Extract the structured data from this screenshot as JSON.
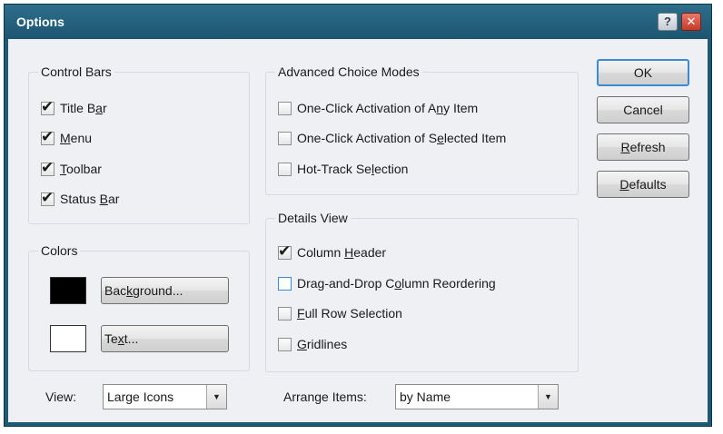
{
  "window": {
    "title": "Options",
    "help_label": "?",
    "close_label": "✕"
  },
  "control_bars": {
    "title": "Control Bars",
    "items": [
      {
        "pre": "Title B",
        "key": "a",
        "post": "r",
        "checked": true
      },
      {
        "pre": "",
        "key": "M",
        "post": "enu",
        "checked": true
      },
      {
        "pre": "",
        "key": "T",
        "post": "oolbar",
        "checked": true
      },
      {
        "pre": "Status ",
        "key": "B",
        "post": "ar",
        "checked": true
      }
    ]
  },
  "colors": {
    "title": "Colors",
    "background": {
      "pre": "Bac",
      "key": "k",
      "post": "ground...",
      "swatch": "#000000"
    },
    "text": {
      "pre": "Te",
      "key": "x",
      "post": "t...",
      "swatch": "#ffffff"
    }
  },
  "advanced": {
    "title": "Advanced Choice Modes",
    "items": [
      {
        "pre": "One-Click Activation of A",
        "key": "n",
        "post": "y Item",
        "checked": false
      },
      {
        "pre": "One-Click Activation of S",
        "key": "e",
        "post": "lected Item",
        "checked": false
      },
      {
        "pre": "Hot-Track Se",
        "key": "l",
        "post": "ection",
        "checked": false
      }
    ]
  },
  "details": {
    "title": "Details View",
    "items": [
      {
        "pre": "Column ",
        "key": "H",
        "post": "eader",
        "checked": true
      },
      {
        "pre": "Drag-and-Drop C",
        "key": "o",
        "post": "lumn Reordering",
        "checked": false
      },
      {
        "pre": "",
        "key": "F",
        "post": "ull Row Selection",
        "checked": false
      },
      {
        "pre": "",
        "key": "G",
        "post": "ridlines",
        "checked": false
      }
    ]
  },
  "buttons": {
    "ok": {
      "pre": "OK",
      "key": "",
      "post": ""
    },
    "cancel": {
      "pre": "Cancel",
      "key": "",
      "post": ""
    },
    "refresh": {
      "pre": "",
      "key": "R",
      "post": "efresh"
    },
    "defaults": {
      "pre": "",
      "key": "D",
      "post": "efaults"
    }
  },
  "view": {
    "label": "View:",
    "value": "Large Icons",
    "arrow": "▼"
  },
  "arrange": {
    "label": "Arrange Items:",
    "value": "by Name",
    "arrow": "▼"
  }
}
